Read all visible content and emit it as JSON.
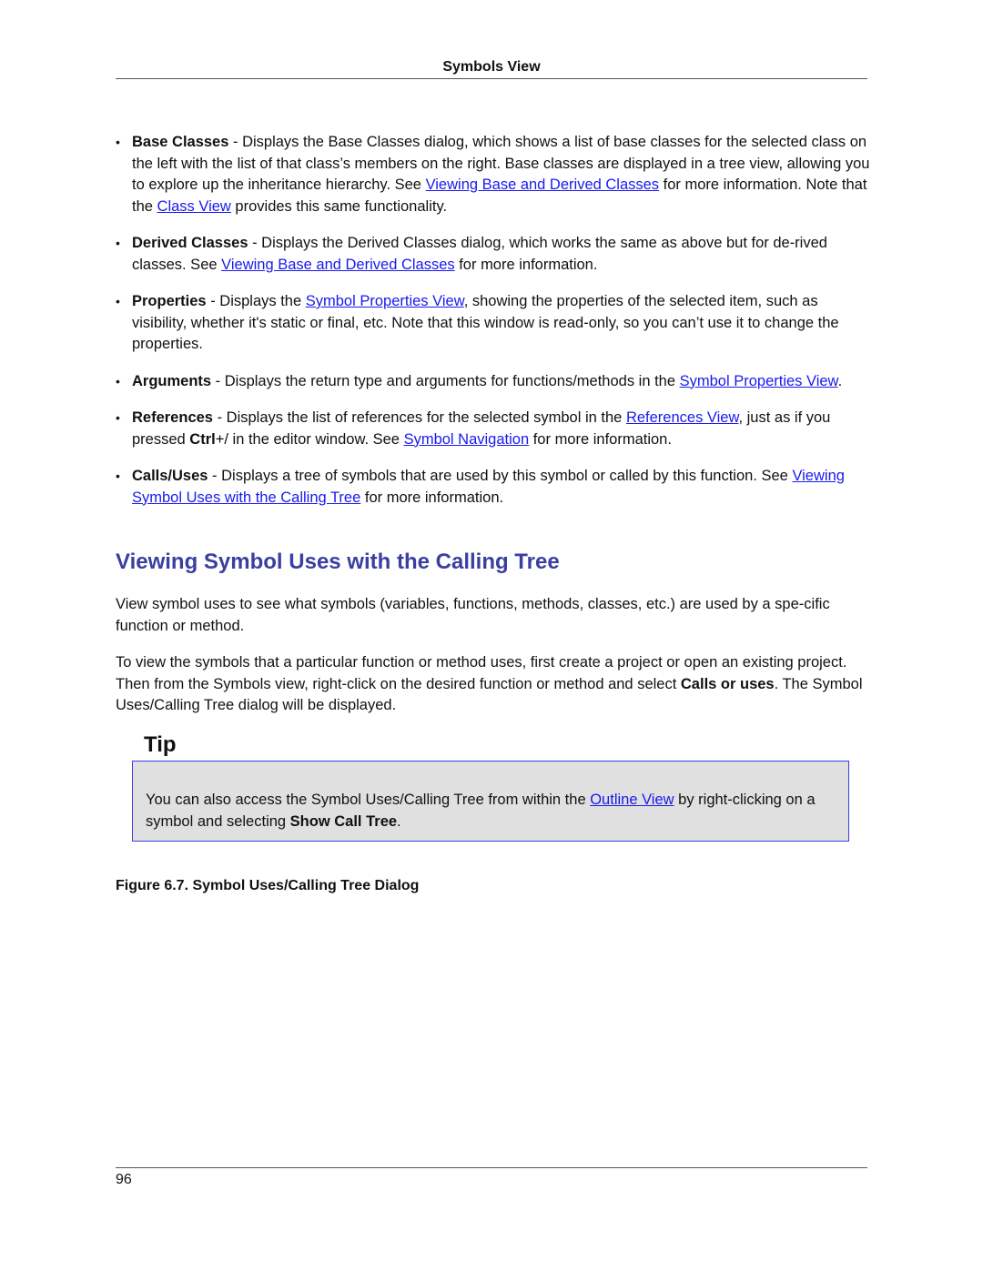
{
  "header": {
    "title": "Symbols View"
  },
  "bullets": [
    {
      "term": "Base Classes",
      "t1": " - Displays the Base Classes dialog, which shows a list of base classes for the selected class on the left with the list of that class’s members on the right. Base classes are displayed in a tree view, allowing you to explore up the inheritance hierarchy. See ",
      "link1": "Viewing Base and Derived Classes",
      "t2": " for more information. Note that the ",
      "link2": "Class View",
      "t3": " provides this same functionality."
    },
    {
      "term": "Derived Classes",
      "t1": " - Displays the Derived Classes dialog, which works the same as above but for de-rived classes. See ",
      "link1": "Viewing Base and Derived Classes",
      "t2": " for more information."
    },
    {
      "term": "Properties",
      "t1": " - Displays the ",
      "link1": "Symbol Properties View",
      "t2": ", showing the properties of the selected item, such as visibility, whether it's static or final, etc. Note that this window is read-only, so you can’t use it to change the properties."
    },
    {
      "term": "Arguments",
      "t1": " - Displays the return type and arguments for functions/methods in the ",
      "link1": "Symbol Properties View",
      "t2": "."
    },
    {
      "term": "References",
      "t1": " - Displays the list of references for the selected symbol in the ",
      "link1": "References View",
      "t2": ", just as if you pressed ",
      "key": "Ctrl",
      "t3": "+/ in the editor window. See ",
      "link2": "Symbol Navigation",
      "t4": " for more information."
    },
    {
      "term": "Calls/Uses",
      "t1": " - Displays a tree of symbols that are used by this symbol or called by this function. See ",
      "link1": "Viewing Symbol Uses with the Calling Tree",
      "t2": " for more information."
    }
  ],
  "section": {
    "title": "Viewing Symbol Uses with the Calling Tree",
    "p1": "View symbol uses to see what symbols (variables, functions, methods, classes, etc.) are used by a spe-cific function or method.",
    "p2_a": "To view the symbols that a particular function or method uses, first create a project or open an existing project. Then from the Symbols view, right-click on the desired function or method and select ",
    "p2_bold": "Calls or uses",
    "p2_b": ". The Symbol Uses/Calling Tree dialog will be displayed."
  },
  "tip": {
    "title": "Tip",
    "t1": "You can also access the Symbol Uses/Calling Tree from within the ",
    "link": "Outline View",
    "t2": " by right-clicking on a symbol and selecting ",
    "bold": "Show Call Tree",
    "t3": "."
  },
  "figure": {
    "caption": "Figure 6.7. Symbol Uses/Calling Tree Dialog"
  },
  "footer": {
    "page_number": "96"
  },
  "colors": {
    "heading": "#3a3fa0",
    "link": "#1a1aee",
    "tip_bg": "#e0e0e0",
    "tip_border": "#3b3bee"
  }
}
